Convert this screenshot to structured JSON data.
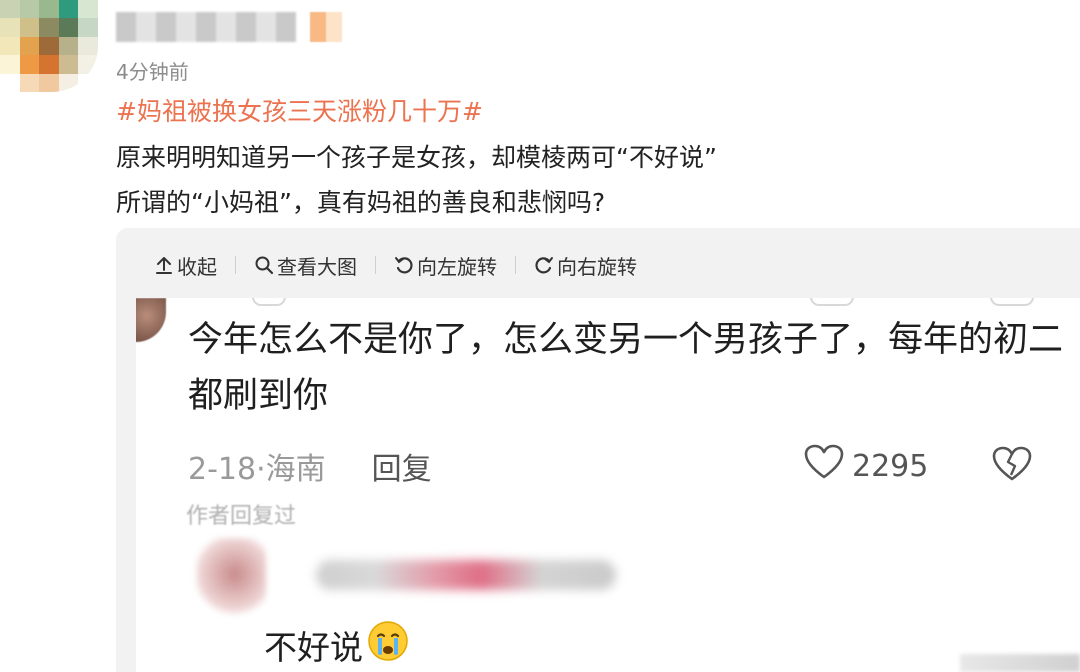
{
  "post": {
    "time": "4分钟前",
    "hashtag": "#妈祖被换女孩三天涨粉几十万#",
    "line1": "原来明明知道另一个孩子是女孩，却模棱两可“不好说”",
    "line2": "所谓的“小妈祖”，真有妈祖的善良和悲悯吗?"
  },
  "toolbar": {
    "collapse": "收起",
    "view_large": "查看大图",
    "rotate_left": "向左旋转",
    "rotate_right": "向右旋转"
  },
  "screenshot": {
    "comment": "今年怎么不是你了，怎么变另一个男孩子了，每年的初二都刷到你",
    "date": "2-18",
    "location": "海南",
    "reply_label": "回复",
    "like_count": "2295",
    "author_replied": "作者回复过",
    "reply_text": "不好说"
  },
  "icons": [
    "arrow-up-icon",
    "magnifier-icon",
    "rotate-left-icon",
    "rotate-right-icon",
    "heart-icon",
    "broken-heart-icon",
    "crying-emoji-icon"
  ],
  "colors": {
    "hashtag": "#eb7350",
    "card_bg": "#f2f2f2",
    "muted": "#8c8c8c"
  }
}
